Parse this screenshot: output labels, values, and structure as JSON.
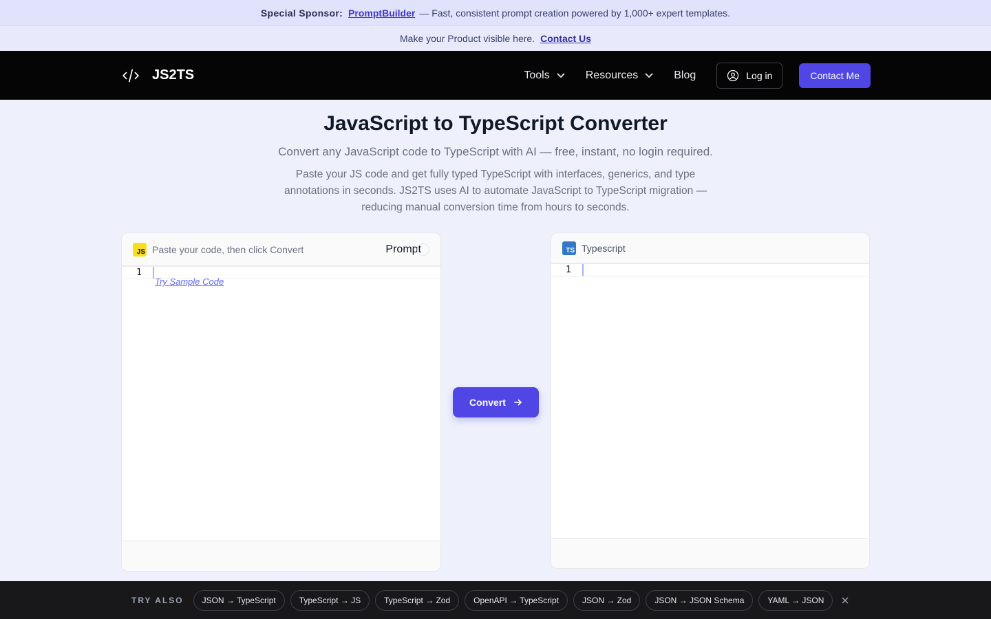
{
  "sponsor": {
    "label": "Special Sponsor:",
    "link": "PromptBuilder",
    "text": "— Fast, consistent prompt creation powered by 1,000+ expert templates."
  },
  "promo": {
    "text": "Make your Product visible here.",
    "link": "Contact Us"
  },
  "nav": {
    "brand": "JS2TS",
    "tools": "Tools",
    "resources": "Resources",
    "blog": "Blog",
    "login": "Log in",
    "contact": "Contact Me"
  },
  "hero": {
    "title": "JavaScript to TypeScript Converter",
    "subtitle": "Convert any JavaScript code to TypeScript with AI — free, instant, no login required.",
    "description": "Paste your JS code and get fully typed TypeScript with interfaces, generics, and type annotations in seconds. JS2TS uses AI to automate JavaScript to TypeScript migration — reducing manual conversion time from hours to seconds."
  },
  "input_panel": {
    "badge": "JS",
    "placeholder": "Paste your code, then click Convert",
    "prompt_label": "Prompt",
    "line_number": "1",
    "sample_link": "Try Sample Code"
  },
  "output_panel": {
    "badge": "TS",
    "title": "Typescript",
    "line_number": "1"
  },
  "convert": {
    "label": "Convert"
  },
  "try_also": {
    "label": "TRY ALSO",
    "chips": [
      "JSON → TypeScript",
      "TypeScript → JS",
      "TypeScript → Zod",
      "OpenAPI → TypeScript",
      "JSON → Zod",
      "JSON → JSON Schema",
      "YAML → JSON"
    ]
  },
  "colors": {
    "accent": "#4f46e5",
    "nav_bg": "#050505",
    "page_bg": "#eef1fb"
  }
}
